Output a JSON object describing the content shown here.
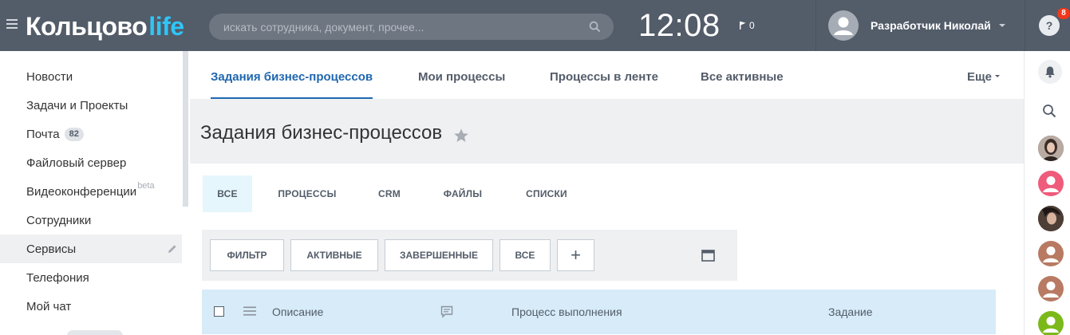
{
  "header": {
    "logo_main": "Кольцово",
    "logo_accent": "life",
    "search_placeholder": "искать сотрудника, документ, прочее...",
    "time": "12:08",
    "flag_count": "0",
    "user_name": "Разработчик Николай",
    "help_label": "?"
  },
  "sidebar": {
    "items": [
      {
        "label": "Новости"
      },
      {
        "label": "Задачи и Проекты"
      },
      {
        "label": "Почта",
        "counter": "82"
      },
      {
        "label": "Файловый сервер"
      },
      {
        "label": "Видеоконференции",
        "badge": "beta"
      },
      {
        "label": "Сотрудники"
      },
      {
        "label": "Сервисы",
        "active": true
      },
      {
        "label": "Телефония"
      },
      {
        "label": "Мой чат"
      }
    ]
  },
  "topnav": {
    "tabs": [
      {
        "label": "Задания бизнес-процессов",
        "active": true
      },
      {
        "label": "Мои процессы"
      },
      {
        "label": "Процессы в ленте"
      },
      {
        "label": "Все активные"
      }
    ],
    "more": "Еще"
  },
  "page": {
    "title": "Задания бизнес-процессов"
  },
  "subtabs": [
    {
      "label": "ВСЕ",
      "active": true
    },
    {
      "label": "ПРОЦЕССЫ"
    },
    {
      "label": "CRM"
    },
    {
      "label": "ФАЙЛЫ"
    },
    {
      "label": "СПИСКИ"
    }
  ],
  "filters": {
    "buttons": [
      "ФИЛЬТР",
      "АКТИВНЫЕ",
      "ЗАВЕРШЕННЫЕ",
      "ВСЕ"
    ],
    "add": "+"
  },
  "table": {
    "columns": [
      "Описание",
      "Процесс выполнения",
      "Задание"
    ]
  },
  "rightpanel": {
    "notifications_count": "8"
  },
  "colors": {
    "header_bg": "#535c69",
    "accent": "#2fc6f6",
    "link_active": "#2067b0",
    "badge_red": "#f0371c",
    "avatar_pink": "#ef5b7a",
    "avatar_brown": "#b87a63",
    "avatar_green": "#7bb91b"
  }
}
